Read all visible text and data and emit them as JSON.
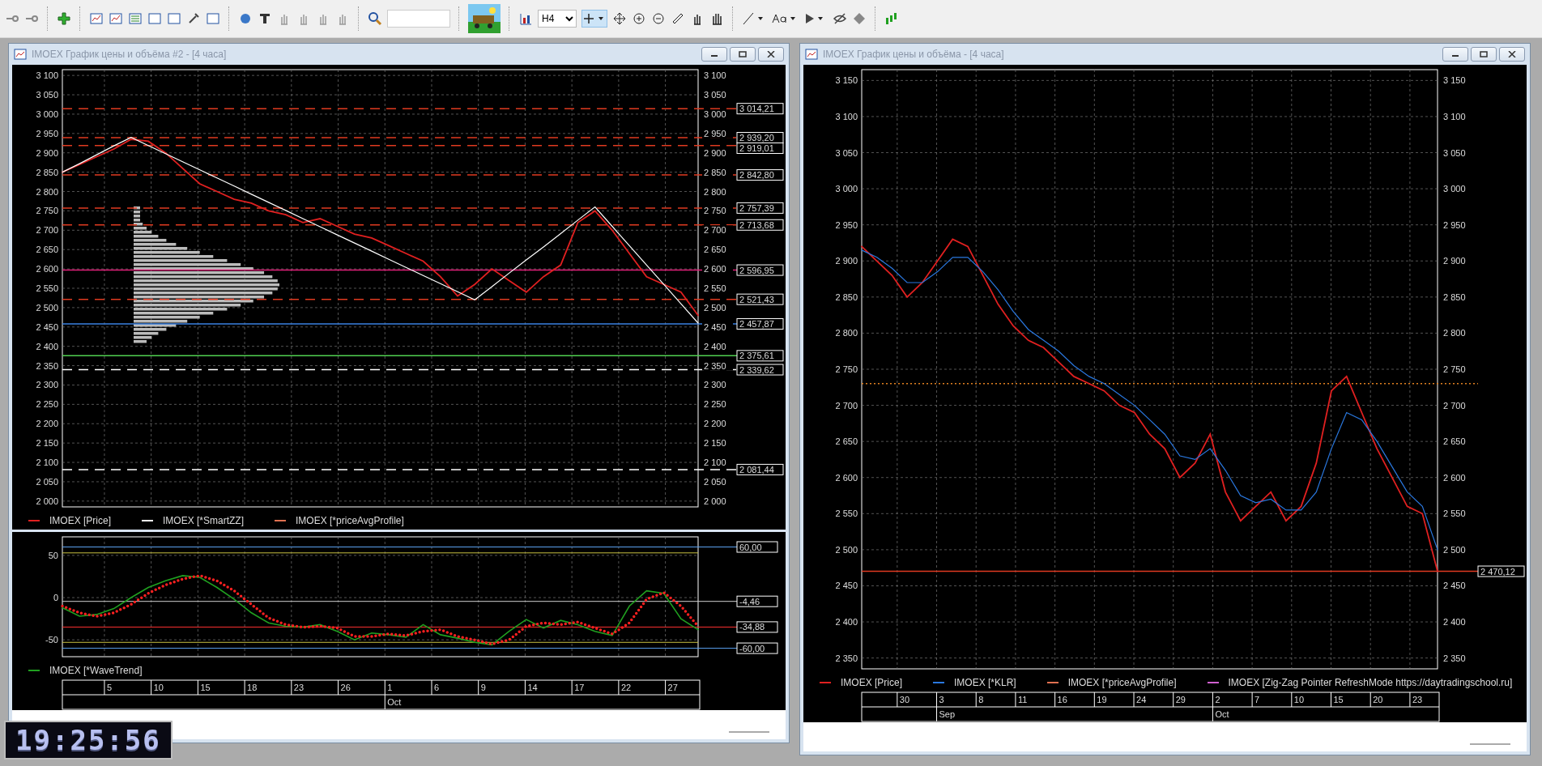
{
  "toolbar": {
    "timeframe": "H4"
  },
  "clock": {
    "time": "19:25:56"
  },
  "windows": [
    {
      "title": "IMOEX График цены и объёма #2 - [4 часа]",
      "chart_data": {
        "type": "line",
        "ylim": [
          1985,
          3115
        ],
        "grid": true,
        "series": [
          {
            "name": "IMOEX [Price]",
            "color": "#e02020",
            "values": [
              2850,
              2870,
              2890,
              2910,
              2935,
              2930,
              2900,
              2860,
              2820,
              2800,
              2780,
              2770,
              2750,
              2740,
              2720,
              2730,
              2710,
              2690,
              2680,
              2660,
              2640,
              2620,
              2580,
              2530,
              2560,
              2600,
              2570,
              2540,
              2580,
              2610,
              2720,
              2750,
              2700,
              2640,
              2580,
              2560,
              2540,
              2480
            ]
          },
          {
            "name": "IMOEX [*SmartZZ]",
            "color": "#ffffff",
            "values": [
              2850,
              2872,
              2895,
              2918,
              2940,
              2919,
              2898,
              2877,
              2856,
              2835,
              2814,
              2793,
              2772,
              2751,
              2730,
              2709,
              2688,
              2667,
              2646,
              2625,
              2604,
              2583,
              2562,
              2541,
              2520,
              2554,
              2589,
              2623,
              2657,
              2691,
              2726,
              2760,
              2710,
              2660,
              2610,
              2560,
              2510,
              2460
            ]
          }
        ],
        "yticks": [
          {
            "value": 3100,
            "label": "3 100"
          },
          {
            "value": 3050,
            "label": "3 050"
          },
          {
            "value": 3000,
            "label": "3 000"
          },
          {
            "value": 2950,
            "label": "2 950"
          },
          {
            "value": 2900,
            "label": "2 900"
          },
          {
            "value": 2850,
            "label": "2 850"
          },
          {
            "value": 2800,
            "label": "2 800"
          },
          {
            "value": 2750,
            "label": "2 750"
          },
          {
            "value": 2700,
            "label": "2 700"
          },
          {
            "value": 2650,
            "label": "2 650"
          },
          {
            "value": 2600,
            "label": "2 600"
          },
          {
            "value": 2550,
            "label": "2 550"
          },
          {
            "value": 2500,
            "label": "2 500"
          },
          {
            "value": 2450,
            "label": "2 450"
          },
          {
            "value": 2400,
            "label": "2 400"
          },
          {
            "value": 2350,
            "label": "2 350"
          },
          {
            "value": 2300,
            "label": "2 300"
          },
          {
            "value": 2250,
            "label": "2 250"
          },
          {
            "value": 2200,
            "label": "2 200"
          },
          {
            "value": 2150,
            "label": "2 150"
          },
          {
            "value": 2100,
            "label": "2 100"
          },
          {
            "value": 2050,
            "label": "2 050"
          },
          {
            "value": 2000,
            "label": "2 000"
          }
        ],
        "ref_lines": [
          {
            "axis": "y",
            "value": 3014.21,
            "label": "3 014,21",
            "color": "#e03a20",
            "line_style": "dashed"
          },
          {
            "axis": "y",
            "value": 2939.2,
            "label": "2 939,20",
            "color": "#e03a20",
            "line_style": "dashed"
          },
          {
            "axis": "y",
            "value": 2919.01,
            "label": "2 919,01",
            "color": "#e03a20",
            "line_style": "dashed"
          },
          {
            "axis": "y",
            "value": 2842.8,
            "label": "2 842,80",
            "color": "#e03a20",
            "line_style": "dashed"
          },
          {
            "axis": "y",
            "value": 2757.39,
            "label": "2 757,39",
            "color": "#e03a20",
            "line_style": "dashed"
          },
          {
            "axis": "y",
            "value": 2713.68,
            "label": "2 713,68",
            "color": "#e03a20",
            "line_style": "dashed"
          },
          {
            "axis": "y",
            "value": 2596.95,
            "label": "2 596,95",
            "color": "#e0207a"
          },
          {
            "axis": "y",
            "value": 2521.43,
            "label": "2 521,43",
            "color": "#e03a20",
            "line_style": "dashed"
          },
          {
            "axis": "y",
            "value": 2457.87,
            "label": "2 457,87",
            "color": "#3a80e0"
          },
          {
            "axis": "y",
            "value": 2375.61,
            "label": "2 375,61",
            "color": "#50d050"
          },
          {
            "axis": "y",
            "value": 2339.62,
            "label": "2 339,62",
            "color": "#ffffff",
            "line_style": "dashed"
          },
          {
            "axis": "y",
            "value": 2081.44,
            "label": "2 081,44",
            "color": "#ffffff",
            "line_style": "dashed"
          }
        ]
      },
      "right_axis": [
        "3 100",
        "3 050",
        "3 000",
        "2 950",
        "2 900",
        "2 850",
        "2 800",
        "2 750",
        "2 700",
        "2 650",
        "2 600",
        "2 550",
        "2 500",
        "2 450",
        "2 400",
        "2 350",
        "2 300",
        "2 250",
        "2 200",
        "2 150",
        "2 100",
        "2 050",
        "2 000"
      ],
      "legend": [
        {
          "label": "IMOEX [*priceAvgProfile]",
          "color": "#e07050"
        }
      ],
      "oscillator": {
        "chart_data": {
          "type": "line",
          "ylim": [
            -70,
            72
          ],
          "grid": true,
          "series": [
            {
              "name": "IMOEX [*WaveTrend]",
              "color": "#20a020",
              "values": [
                -12,
                -22,
                -20,
                -13,
                0,
                12,
                20,
                26,
                24,
                12,
                -2,
                -18,
                -30,
                -34,
                -35,
                -32,
                -40,
                -50,
                -42,
                -44,
                -47,
                -32,
                -44,
                -48,
                -53,
                -56,
                -40,
                -26,
                -36,
                -27,
                -32,
                -40,
                -45,
                -10,
                8,
                5,
                -25,
                -38
              ]
            },
            {
              "color": "#ff2020",
              "line_style": "dotted",
              "values": [
                -10,
                -18,
                -22,
                -18,
                -8,
                5,
                15,
                22,
                26,
                20,
                8,
                -8,
                -24,
                -32,
                -35,
                -34,
                -36,
                -46,
                -46,
                -43,
                -45,
                -40,
                -38,
                -46,
                -50,
                -55,
                -50,
                -34,
                -30,
                -32,
                -29,
                -36,
                -43,
                -30,
                -2,
                6,
                -10,
                -34
              ]
            }
          ],
          "yticks": [
            {
              "value": 50,
              "label": "50"
            },
            {
              "value": 0,
              "label": "0"
            },
            {
              "value": -50,
              "label": "-50"
            }
          ],
          "ref_lines": [
            {
              "axis": "y",
              "value": 60,
              "label": "60,00",
              "color": "#5aa0f0"
            },
            {
              "axis": "y",
              "value": 53,
              "color": "#c8c040"
            },
            {
              "axis": "y",
              "value": -4.46,
              "label": "-4,46",
              "color": "#d0d0d0"
            },
            {
              "axis": "y",
              "value": -34.88,
              "label": "-34,88",
              "color": "#ff3030"
            },
            {
              "axis": "y",
              "value": -53,
              "color": "#c8c040"
            },
            {
              "axis": "y",
              "value": -60,
              "label": "-60,00",
              "color": "#5aa0f0"
            }
          ]
        }
      },
      "date_axis": {
        "days": [
          "5",
          "10",
          "15",
          "18",
          "23",
          "26",
          "1",
          "6",
          "9",
          "14",
          "17",
          "22",
          "27"
        ],
        "months": [
          "Oct"
        ]
      }
    },
    {
      "title": "IMOEX График цены и объёма - [4 часа]",
      "chart_data": {
        "type": "line",
        "ylim": [
          2335,
          3165
        ],
        "grid": true,
        "series": [
          {
            "name": "IMOEX [Price]",
            "color": "#e02020",
            "values": [
              2920,
              2900,
              2880,
              2850,
              2870,
              2900,
              2930,
              2920,
              2880,
              2840,
              2810,
              2790,
              2780,
              2760,
              2740,
              2730,
              2720,
              2700,
              2690,
              2660,
              2640,
              2600,
              2620,
              2660,
              2580,
              2540,
              2560,
              2580,
              2540,
              2560,
              2620,
              2720,
              2740,
              2690,
              2640,
              2600,
              2560,
              2550,
              2470
            ]
          },
          {
            "name": "IMOEX [*KLR]",
            "color": "#2a78e0",
            "values": [
              2915,
              2905,
              2890,
              2870,
              2870,
              2885,
              2905,
              2905,
              2885,
              2860,
              2830,
              2805,
              2790,
              2775,
              2755,
              2740,
              2730,
              2715,
              2700,
              2680,
              2660,
              2630,
              2625,
              2640,
              2610,
              2575,
              2565,
              2570,
              2555,
              2555,
              2580,
              2640,
              2690,
              2680,
              2650,
              2615,
              2580,
              2560,
              2500
            ]
          }
        ],
        "yticks": [
          {
            "value": 3150,
            "label": "3 150"
          },
          {
            "value": 3100,
            "label": "3 100"
          },
          {
            "value": 3050,
            "label": "3 050"
          },
          {
            "value": 3000,
            "label": "3 000"
          },
          {
            "value": 2950,
            "label": "2 950"
          },
          {
            "value": 2900,
            "label": "2 900"
          },
          {
            "value": 2850,
            "label": "2 850"
          },
          {
            "value": 2800,
            "label": "2 800"
          },
          {
            "value": 2750,
            "label": "2 750"
          },
          {
            "value": 2700,
            "label": "2 700"
          },
          {
            "value": 2650,
            "label": "2 650"
          },
          {
            "value": 2600,
            "label": "2 600"
          },
          {
            "value": 2550,
            "label": "2 550"
          },
          {
            "value": 2500,
            "label": "2 500"
          },
          {
            "value": 2450,
            "label": "2 450"
          },
          {
            "value": 2400,
            "label": "2 400"
          },
          {
            "value": 2350,
            "label": "2 350"
          }
        ],
        "ref_lines": [
          {
            "axis": "y",
            "value": 2730,
            "color": "#e08020",
            "line_style": "dotted"
          },
          {
            "axis": "y",
            "value": 2470.12,
            "label": "2 470,12",
            "color": "#e03a20"
          }
        ]
      },
      "right_axis": [
        "3 150",
        "3 100",
        "3 050",
        "3 000",
        "2 950",
        "2 900",
        "2 850",
        "2 800",
        "2 750",
        "2 700",
        "2 650",
        "2 600",
        "2 550",
        "2 500",
        "2 450",
        "2 400",
        "2 350"
      ],
      "legend": [
        {
          "label": "IMOEX [*priceAvgProfile]",
          "color": "#e07050"
        },
        {
          "label": "IMOEX [Zig-Zag Pointer RefreshMode https://daytradingschool.ru]",
          "color": "#d060d0"
        }
      ],
      "date_axis": {
        "days": [
          "30",
          "3",
          "8",
          "11",
          "16",
          "19",
          "24",
          "29",
          "2",
          "7",
          "10",
          "15",
          "20",
          "23"
        ],
        "months": [
          "Sep",
          "Oct"
        ]
      }
    }
  ]
}
